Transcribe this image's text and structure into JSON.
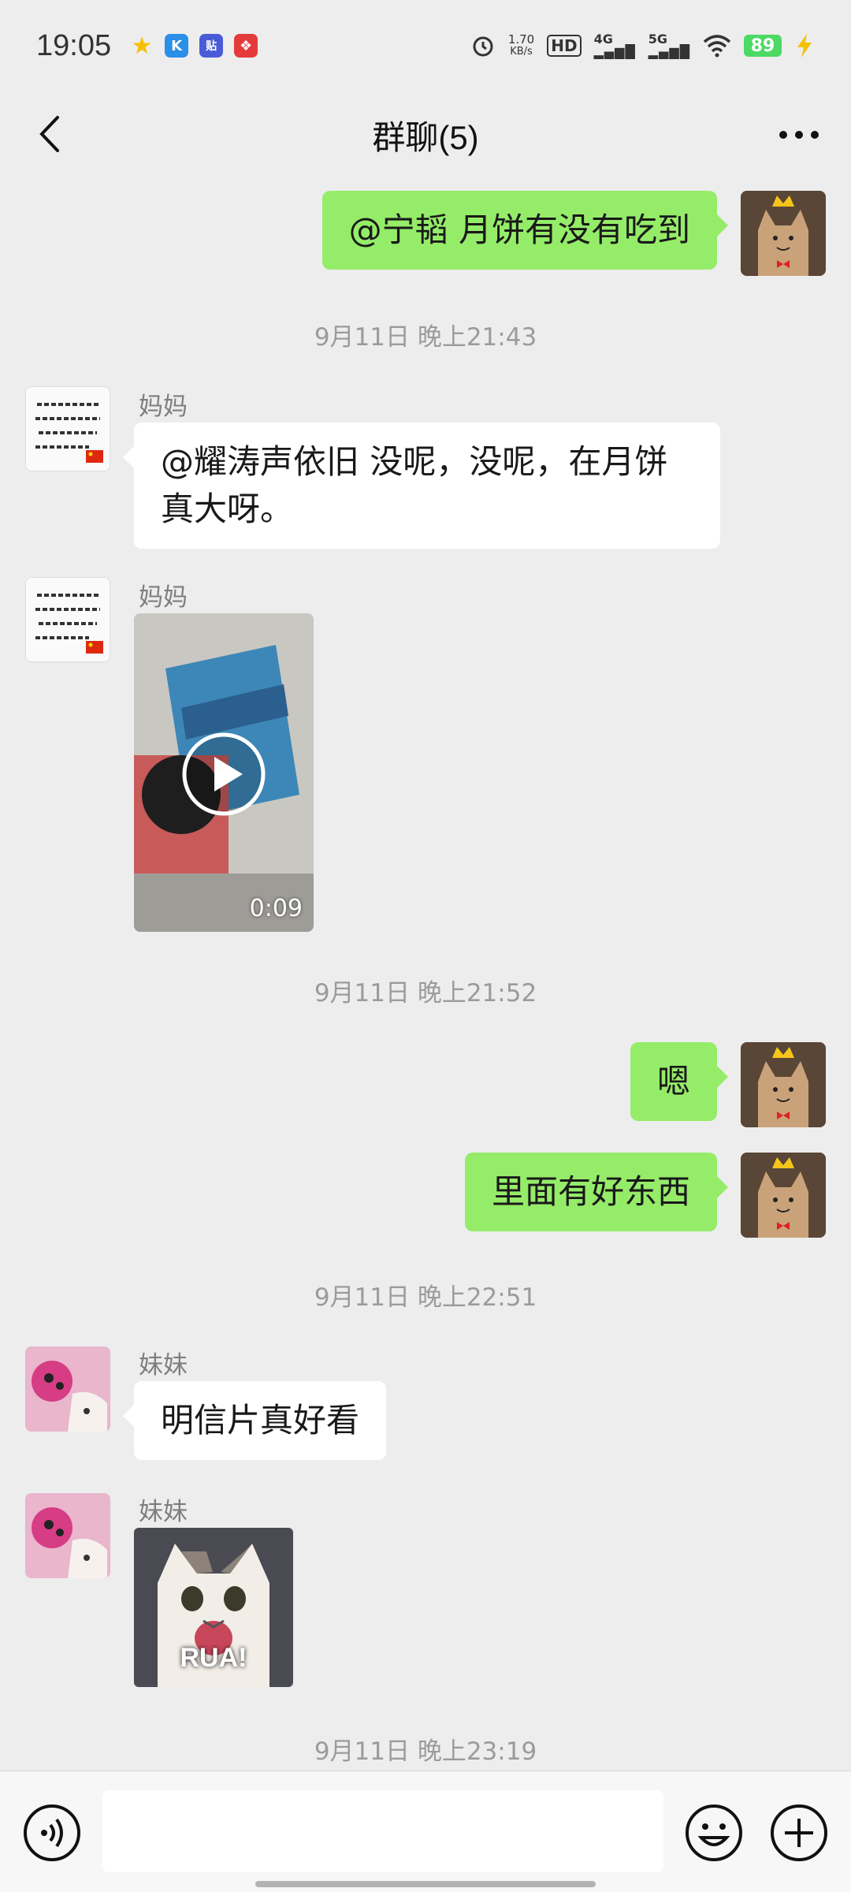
{
  "status_bar": {
    "time": "19:05",
    "net_speed_value": "1.70",
    "net_speed_unit": "KB/s",
    "hd_label": "HD",
    "signal_4g": "4G",
    "signal_5g": "5G",
    "battery": "89",
    "app_icons": [
      "star-app-icon",
      "k-app-icon",
      "tieba-app-icon",
      "red-app-icon"
    ],
    "icons": [
      "alarm-icon",
      "wifi-icon",
      "charging-icon"
    ]
  },
  "header": {
    "title": "群聊(5)",
    "back_icon": "chevron-left-icon",
    "more_icon": "more-dots-icon"
  },
  "messages": {
    "m1": {
      "sender": "self",
      "text": "@宁韬  月饼有没有吃到"
    },
    "ts1": "9月11日 晚上21:43",
    "m2": {
      "sender": "妈妈",
      "text": "@耀涛声依旧  没呢，没呢，在月饼真大呀。"
    },
    "m3": {
      "sender": "妈妈",
      "type": "video",
      "duration": "0:09"
    },
    "ts2": "9月11日 晚上21:52",
    "m4": {
      "sender": "self",
      "text": "嗯"
    },
    "m5": {
      "sender": "self",
      "text": "里面有好东西"
    },
    "ts3": "9月11日 晚上22:51",
    "m6": {
      "sender": "妹妹",
      "text": "明信片真好看"
    },
    "m7": {
      "sender": "妹妹",
      "type": "sticker",
      "caption": "RUA!"
    },
    "ts4": "9月11日 晚上23:19"
  },
  "input_bar": {
    "placeholder": "",
    "voice_icon": "voice-icon",
    "emoji_icon": "emoji-icon",
    "plus_icon": "plus-icon"
  },
  "colors": {
    "background": "#ededed",
    "outgoing_bubble": "#95ec69",
    "incoming_bubble": "#ffffff",
    "battery": "#4cd964"
  }
}
